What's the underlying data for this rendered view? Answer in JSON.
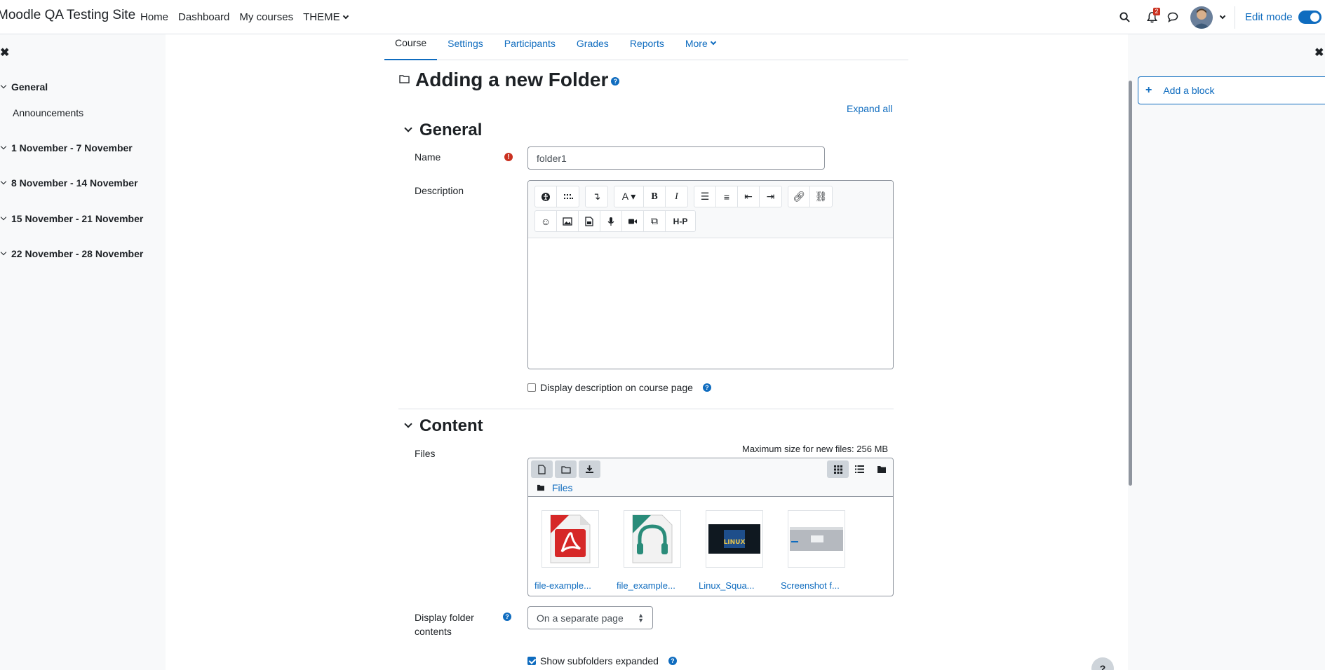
{
  "site": {
    "name": "Moodle QA Testing Site"
  },
  "primary_nav": [
    {
      "label": "Home"
    },
    {
      "label": "Dashboard"
    },
    {
      "label": "My courses"
    },
    {
      "label": "THEME"
    }
  ],
  "navbar": {
    "notification_count": "2",
    "edit_mode_label": "Edit mode"
  },
  "left_drawer": {
    "close_glyph": "✖",
    "sections": [
      {
        "label": "General"
      },
      {
        "label": "1 November - 7 November"
      },
      {
        "label": "8 November - 14 November"
      },
      {
        "label": "15 November - 21 November"
      },
      {
        "label": "22 November - 28 November"
      }
    ],
    "activities": [
      {
        "label": "Announcements"
      }
    ]
  },
  "right_drawer": {
    "close_glyph": "✖",
    "add_block_label": "Add a block"
  },
  "secondary_nav": [
    {
      "label": "Course",
      "active": true
    },
    {
      "label": "Settings"
    },
    {
      "label": "Participants"
    },
    {
      "label": "Grades"
    },
    {
      "label": "Reports"
    },
    {
      "label": "More"
    }
  ],
  "page": {
    "title": "Adding a new Folder",
    "expand_all": "Expand all"
  },
  "general": {
    "header": "General",
    "name_label": "Name",
    "name_value": "folder1",
    "description_label": "Description",
    "display_description_label": "Display description on course page"
  },
  "content": {
    "header": "Content",
    "files_label": "Files",
    "max_size": "Maximum size for new files: 256 MB",
    "path_label": "Files",
    "files": [
      {
        "name": "file-example...",
        "icon": "pdf-icon"
      },
      {
        "name": "file_example...",
        "icon": "audio-icon"
      },
      {
        "name": "Linux_Squa...",
        "icon": "image-thumbnail"
      },
      {
        "name": "Screenshot f...",
        "icon": "screenshot-thumbnail"
      }
    ],
    "display_folder_label_1": "Display folder",
    "display_folder_label_2": "contents",
    "display_folder_value": "On a separate page",
    "show_subfolders_label": "Show subfolders expanded"
  },
  "colors": {
    "primary": "#0f6cbf",
    "danger": "#ca3120",
    "drawer_bg": "#f8f9fa"
  },
  "floating_help": "?"
}
